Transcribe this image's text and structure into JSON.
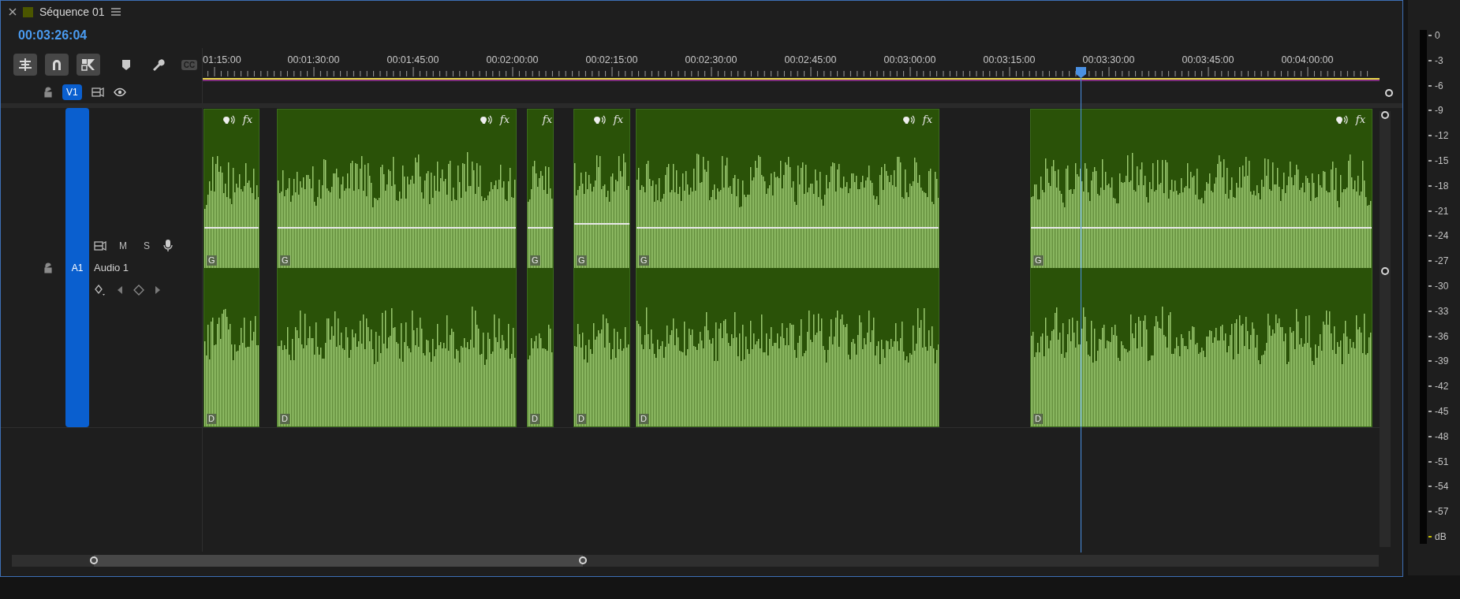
{
  "sequence": {
    "title": "Séquence 01"
  },
  "timecode": "00:03:26:04",
  "toolbar": [
    {
      "kind": "nest",
      "on": true
    },
    {
      "kind": "snap",
      "on": true
    },
    {
      "kind": "linked",
      "on": true
    },
    {
      "kind": "marker",
      "on": false
    },
    {
      "kind": "settings",
      "on": false
    },
    {
      "kind": "captions",
      "text": "CC",
      "on": false
    }
  ],
  "ruler": [
    "01:15:00",
    "00:01:30:00",
    "00:01:45:00",
    "00:02:00:00",
    "00:02:15:00",
    "00:02:30:00",
    "00:02:45:00",
    "00:03:00:00",
    "00:03:15:00",
    "00:03:30:00",
    "00:03:45:00",
    "00:04:00:00"
  ],
  "video_track": {
    "label": "V1",
    "targeted": true
  },
  "audio_track": {
    "label": "A1",
    "targeted": true,
    "name": "Audio 1",
    "mute": "M",
    "solo": "S",
    "clips": [
      {
        "voice_badge": true,
        "fx": "fx",
        "channels": [
          "G",
          "D"
        ]
      },
      {
        "voice_badge": true,
        "fx": "fx",
        "channels": [
          "G",
          "D"
        ]
      },
      {
        "voice_badge": false,
        "fx": "fx",
        "channels": [
          "G",
          "D"
        ]
      },
      {
        "voice_badge": true,
        "fx": "fx",
        "channels": [
          "G",
          "D"
        ]
      },
      {
        "voice_badge": true,
        "fx": "fx",
        "channels": [
          "G",
          "D"
        ]
      },
      {
        "voice_badge": true,
        "fx": "fx",
        "channels": [
          "G",
          "D"
        ]
      }
    ]
  },
  "meter": {
    "scale": [
      "0",
      "-3",
      "-6",
      "-9",
      "-12",
      "-15",
      "-18",
      "-21",
      "-24",
      "-27",
      "-30",
      "-33",
      "-36",
      "-39",
      "-42",
      "-45",
      "-48",
      "-51",
      "-54",
      "-57"
    ],
    "unit": "dB"
  }
}
